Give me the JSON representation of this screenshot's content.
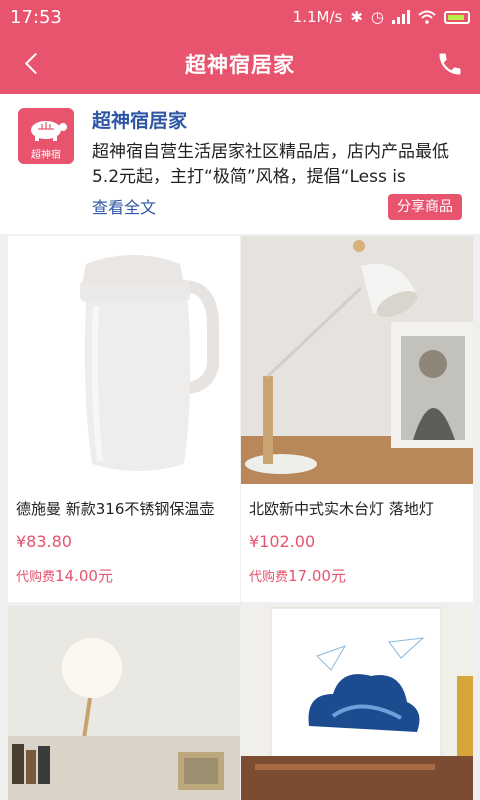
{
  "status_bar": {
    "time": "17:53",
    "net_speed": "1.1M/s"
  },
  "header": {
    "title": "超神宿居家"
  },
  "shop": {
    "logo_text": "超神宿",
    "name": "超神宿居家",
    "description": "超神宿自营生活居家社区精品店，店内产品最低5.2元起，主打“极简”风格，提倡“Less is",
    "more_label": "查看全文",
    "share_label": "分享商品"
  },
  "products": [
    {
      "name": "德施曼 新款316不锈钢保温壶",
      "price": "¥83.80",
      "fee_label": "代购费",
      "fee_value": "14.00元"
    },
    {
      "name": "北欧新中式实木台灯 落地灯",
      "price": "¥102.00",
      "fee_label": "代购费",
      "fee_value": "17.00元"
    },
    {
      "name": "",
      "price": "",
      "fee_label": "",
      "fee_value": ""
    },
    {
      "name": "",
      "price": "",
      "fee_label": "",
      "fee_value": ""
    }
  ],
  "colors": {
    "brand": "#e8536e",
    "link": "#2e56a6"
  }
}
